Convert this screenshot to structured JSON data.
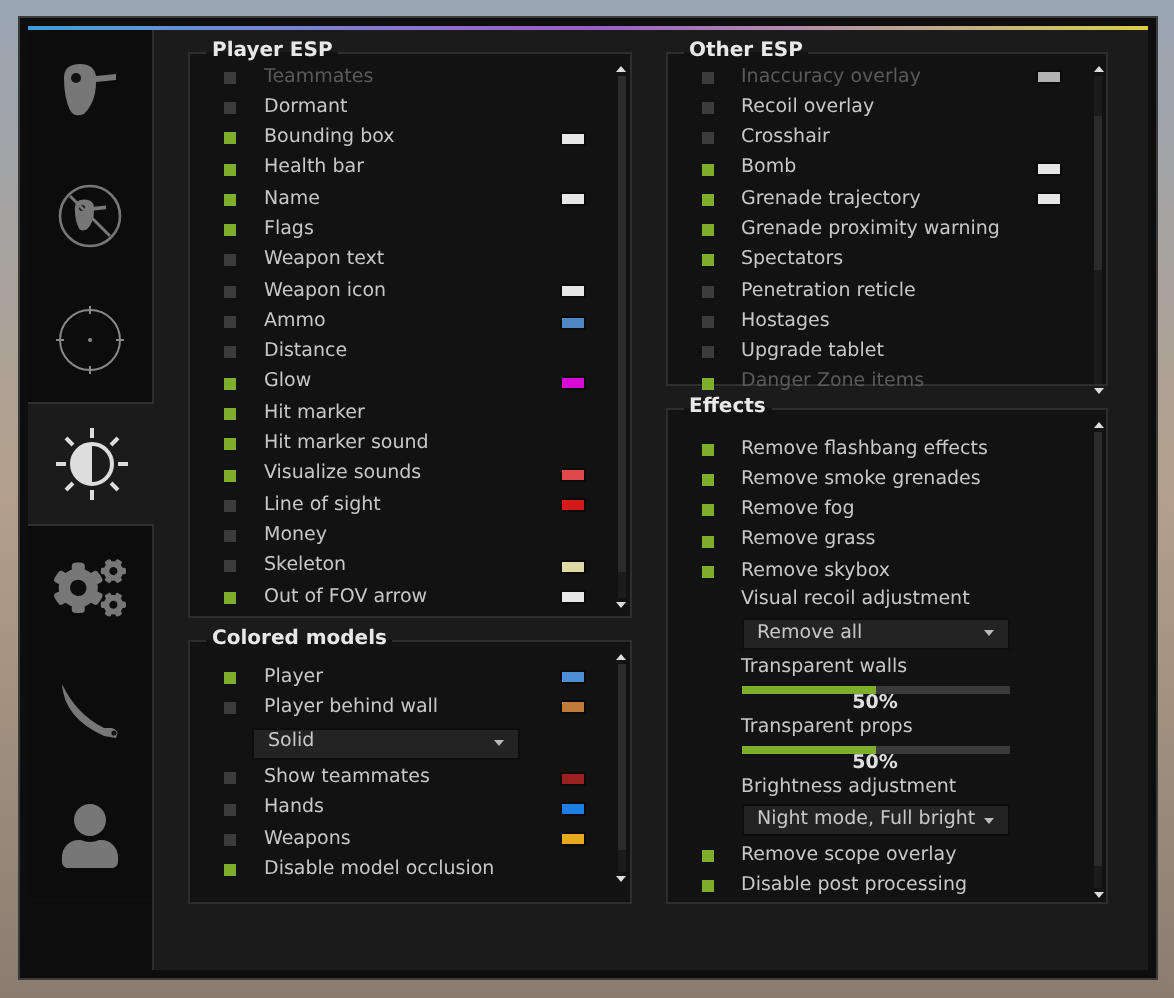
{
  "sidebar": {
    "tabs": [
      {
        "selected": false
      },
      {
        "selected": false
      },
      {
        "selected": false
      },
      {
        "selected": true
      },
      {
        "selected": false
      },
      {
        "selected": false
      },
      {
        "selected": false
      }
    ]
  },
  "player_esp": {
    "title": "Player ESP",
    "items": [
      {
        "label": "Teammates",
        "checked": false,
        "dimmed": true
      },
      {
        "label": "Dormant",
        "checked": false
      },
      {
        "label": "Bounding box",
        "checked": true,
        "color": "#e6e6e6"
      },
      {
        "label": "Health bar",
        "checked": true
      },
      {
        "label": "Name",
        "checked": true,
        "color": "#e6e6e6"
      },
      {
        "label": "Flags",
        "checked": true
      },
      {
        "label": "Weapon text",
        "checked": false
      },
      {
        "label": "Weapon icon",
        "checked": false,
        "color": "#e6e6e6"
      },
      {
        "label": "Ammo",
        "checked": false,
        "color": "#4f86c6"
      },
      {
        "label": "Distance",
        "checked": false
      },
      {
        "label": "Glow",
        "checked": true,
        "color": "#d80bd2"
      },
      {
        "label": "Hit marker",
        "checked": true
      },
      {
        "label": "Hit marker sound",
        "checked": true
      },
      {
        "label": "Visualize sounds",
        "checked": true,
        "color": "#dd4a4a"
      },
      {
        "label": "Line of sight",
        "checked": false,
        "color": "#d41919"
      },
      {
        "label": "Money",
        "checked": false
      },
      {
        "label": "Skeleton",
        "checked": false,
        "color": "#dedaa6"
      },
      {
        "label": "Out of FOV arrow",
        "checked": true,
        "color": "#e6e6e6"
      }
    ]
  },
  "colored_models": {
    "title": "Colored models",
    "items": [
      {
        "kind": "checkbox",
        "label": "Player",
        "checked": true,
        "color": "#4f8fd6"
      },
      {
        "kind": "checkbox",
        "label": "Player behind wall",
        "checked": false,
        "color": "#c07a3c"
      },
      {
        "kind": "dropdown",
        "value": "Solid"
      },
      {
        "kind": "checkbox",
        "label": "Show teammates",
        "checked": false,
        "color": "#9b2121"
      },
      {
        "kind": "checkbox",
        "label": "Hands",
        "checked": false,
        "color": "#1e7fe0"
      },
      {
        "kind": "checkbox",
        "label": "Weapons",
        "checked": false,
        "color": "#e6a81c"
      },
      {
        "kind": "checkbox",
        "label": "Disable model occlusion",
        "checked": true
      }
    ]
  },
  "other_esp": {
    "title": "Other ESP",
    "items": [
      {
        "label": "Inaccuracy overlay",
        "checked": false,
        "dimmed": true,
        "color": "#b0b0b0"
      },
      {
        "label": "Recoil overlay",
        "checked": false
      },
      {
        "label": "Crosshair",
        "checked": false
      },
      {
        "label": "Bomb",
        "checked": true,
        "color": "#e6e6e6"
      },
      {
        "label": "Grenade trajectory",
        "checked": true,
        "color": "#e6e6e6"
      },
      {
        "label": "Grenade proximity warning",
        "checked": true
      },
      {
        "label": "Spectators",
        "checked": true
      },
      {
        "label": "Penetration reticle",
        "checked": false
      },
      {
        "label": "Hostages",
        "checked": false
      },
      {
        "label": "Upgrade tablet",
        "checked": false
      },
      {
        "label": "Danger Zone items",
        "checked": true,
        "dimmed": true
      }
    ]
  },
  "effects": {
    "title": "Effects",
    "items": [
      {
        "kind": "checkbox",
        "label": "Remove flashbang effects",
        "checked": true
      },
      {
        "kind": "checkbox",
        "label": "Remove smoke grenades",
        "checked": true
      },
      {
        "kind": "checkbox",
        "label": "Remove fog",
        "checked": true
      },
      {
        "kind": "checkbox",
        "label": "Remove grass",
        "checked": true
      },
      {
        "kind": "checkbox",
        "label": "Remove skybox",
        "checked": true
      },
      {
        "kind": "dropdown",
        "label": "Visual recoil adjustment",
        "value": "Remove all"
      },
      {
        "kind": "slider",
        "label": "Transparent walls",
        "level": 0.5,
        "reading": "50%"
      },
      {
        "kind": "slider",
        "label": "Transparent props",
        "level": 0.5,
        "reading": "50%"
      },
      {
        "kind": "dropdown",
        "label": "Brightness adjustment",
        "value": "Night mode, Full bright"
      },
      {
        "kind": "checkbox",
        "label": "Remove scope overlay",
        "checked": true
      },
      {
        "kind": "checkbox",
        "label": "Disable post processing",
        "checked": true
      }
    ]
  }
}
